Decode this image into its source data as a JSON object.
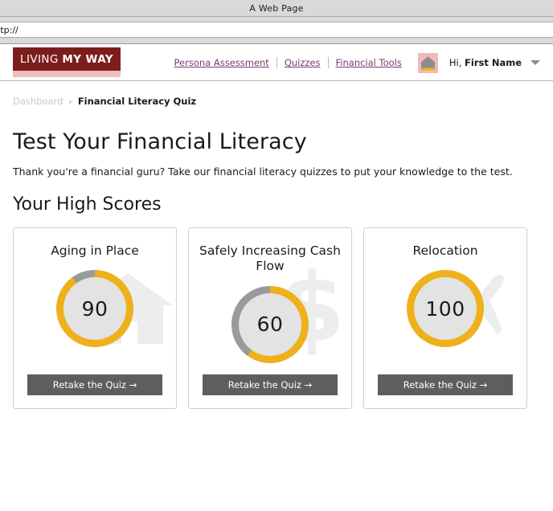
{
  "browser": {
    "window_title": "A Web Page",
    "url_value": "ttp://"
  },
  "header": {
    "logo_first": "LIVING",
    "logo_rest": "MY WAY",
    "nav": [
      {
        "label": "Persona Assessment",
        "name": "nav-persona-assessment"
      },
      {
        "label": "Quizzes",
        "name": "nav-quizzes"
      },
      {
        "label": "Financial Tools",
        "name": "nav-financial-tools"
      }
    ],
    "house_icon": "house-icon",
    "greeting_prefix": "Hi,",
    "greeting_name": "First Name",
    "caret_icon": "chevron-down-icon"
  },
  "breadcrumb": {
    "root": "Dashboard",
    "separator": "›",
    "current": "Financial Literacy Quiz"
  },
  "main": {
    "title": "Test Your Financial Literacy",
    "subtitle": "Thank you're a financial guru? Take our financial literacy quizzes to put your knowledge to the test.",
    "section_title": "Your High Scores"
  },
  "cards": [
    {
      "title": "Aging in Place",
      "score": "90",
      "score_value": 90,
      "watermark": "house-watermark-icon",
      "button_label": "Retake the Quiz →"
    },
    {
      "title": "Safely Increasing Cash Flow",
      "score": "60",
      "score_value": 60,
      "watermark": "dollar-sign-watermark-icon",
      "button_label": "Retake the Quiz →"
    },
    {
      "title": "Relocation",
      "score": "100",
      "score_value": 100,
      "watermark": "airplane-watermark-icon",
      "button_label": "Retake the Quiz →"
    }
  ],
  "colors": {
    "brand_maroon": "#7c1d1d",
    "brand_pink": "#f0bdbd",
    "gauge_gold": "#eeb11c",
    "gauge_track_gray": "#9a9a9a",
    "gauge_fill_gray": "#e3e3e3",
    "button_gray": "#5e5e5e",
    "nav_link": "#7a3b6e",
    "watermark_gray": "#ededed"
  }
}
